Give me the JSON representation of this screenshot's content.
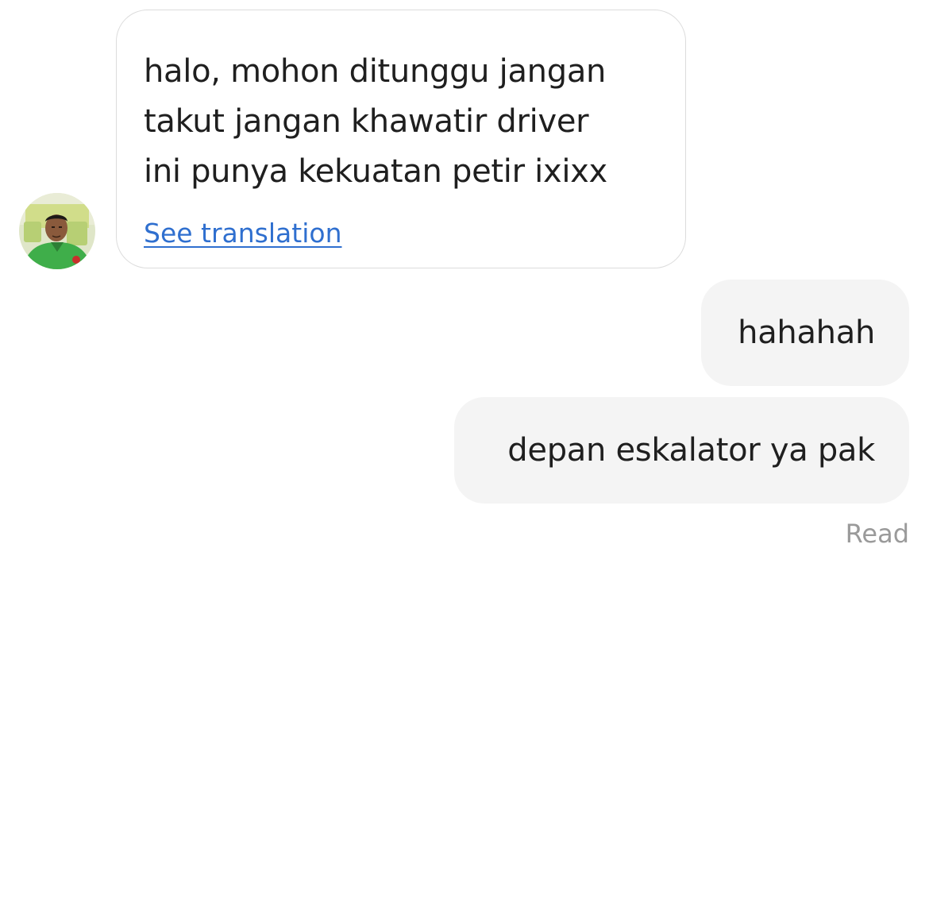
{
  "incoming": {
    "message_text": "halo, mohon ditunggu jangan\ntakut jangan khawatir driver\nini punya kekuatan petir ixixx",
    "translate_link": "See translation"
  },
  "outgoing": [
    {
      "text": "hahahah"
    },
    {
      "text": "depan eskalator ya pak"
    }
  ],
  "status": {
    "read": "Read"
  },
  "colors": {
    "link": "#2f6fcf",
    "outgoing_bubble": "#f4f4f4",
    "incoming_border": "#dcdcdc",
    "status_text": "#9a9a9a",
    "avatar_jacket": "#3fae4a"
  },
  "icons": {
    "avatar": "driver-avatar-photo"
  }
}
